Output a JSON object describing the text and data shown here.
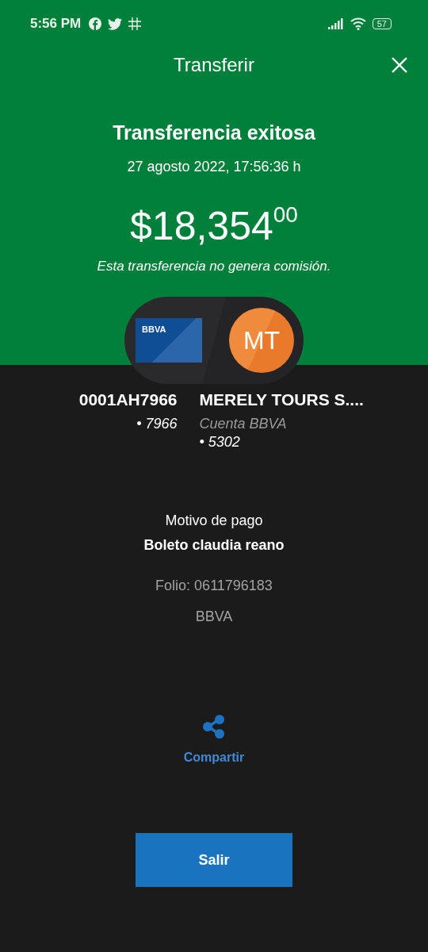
{
  "status_bar": {
    "time": "5:56 PM",
    "battery": "57"
  },
  "header": {
    "title": "Transferir"
  },
  "result": {
    "title": "Transferencia exitosa",
    "datetime": "27 agosto 2022, 17:56:36 h",
    "amount": "$18,354$^{00}$",
    "note": "Esta transferencia no genera comisión."
  },
  "origin": {
    "card_brand": "BBVA",
    "name": "0001AH7966",
    "number": "• 7966"
  },
  "destination": {
    "initials": "MT",
    "name": "MERELY TOURS S....",
    "bank": "Cuenta BBVA",
    "number": "• 5302"
  },
  "details": {
    "label": "Motivo de pago",
    "concept": "Boleto claudia reano",
    "folio": "Folio: 0611796183",
    "bank": "BBVA"
  },
  "share": {
    "label": "Compartir"
  },
  "buttons": [
    {
      "label": "Salir"
    }
  ]
}
